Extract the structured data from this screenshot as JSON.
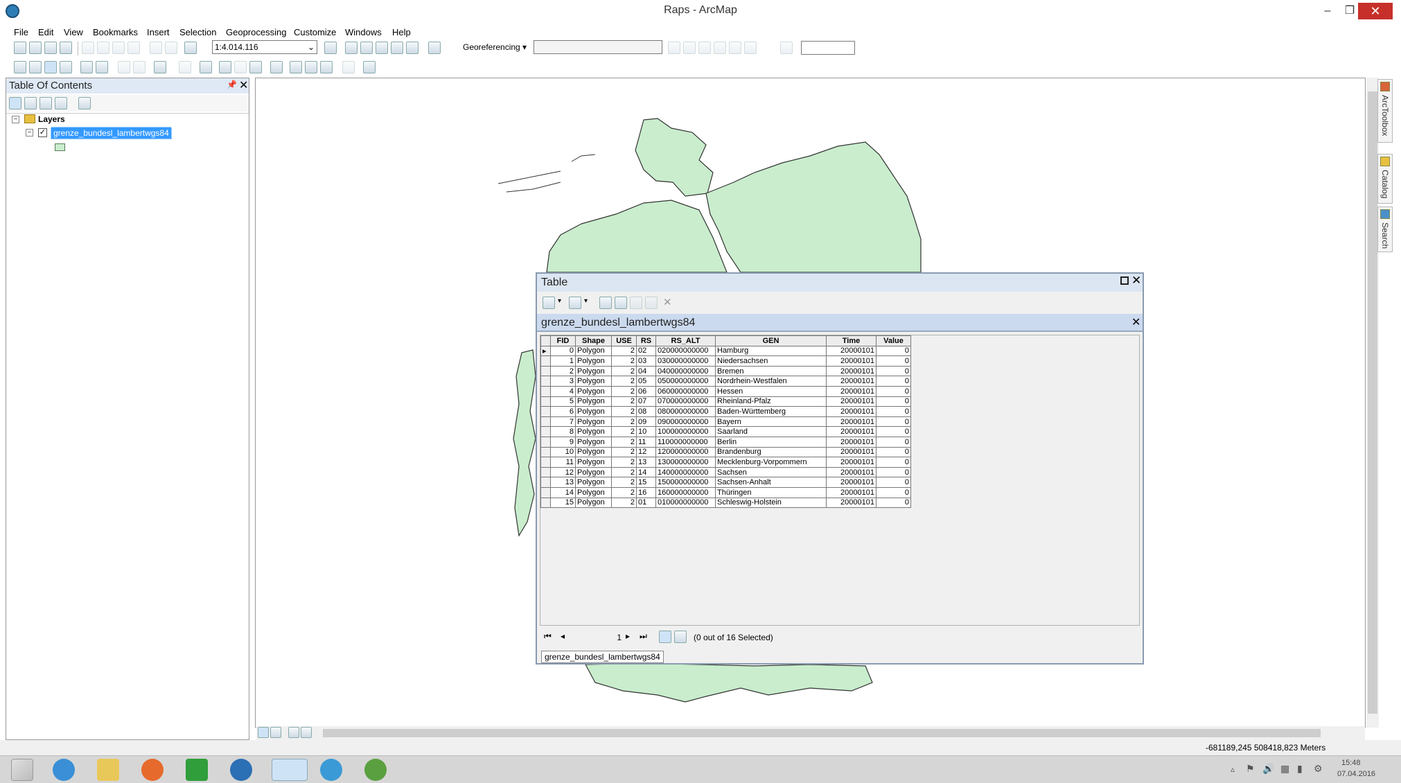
{
  "window": {
    "title": "Raps - ArcMap"
  },
  "menu": [
    "File",
    "Edit",
    "View",
    "Bookmarks",
    "Insert",
    "Selection",
    "Geoprocessing",
    "Customize",
    "Windows",
    "Help"
  ],
  "toolbar": {
    "scale": "1:4.014.116",
    "georeferencing_label": "Georeferencing ▾"
  },
  "toc": {
    "title": "Table Of Contents",
    "root_label": "Layers",
    "layer_name": "grenze_bundesl_lambertwgs84"
  },
  "dock_tabs": [
    "ArcToolbox",
    "Catalog",
    "Search"
  ],
  "table_window": {
    "title": "Table",
    "layer_title": "grenze_bundesl_lambertwgs84",
    "columns": [
      "FID",
      "Shape",
      "USE",
      "RS",
      "RS_ALT",
      "GEN",
      "Time",
      "Value"
    ],
    "rows": [
      [
        "0",
        "Polygon",
        "2",
        "02",
        "020000000000",
        "Hamburg",
        "20000101",
        "0"
      ],
      [
        "1",
        "Polygon",
        "2",
        "03",
        "030000000000",
        "Niedersachsen",
        "20000101",
        "0"
      ],
      [
        "2",
        "Polygon",
        "2",
        "04",
        "040000000000",
        "Bremen",
        "20000101",
        "0"
      ],
      [
        "3",
        "Polygon",
        "2",
        "05",
        "050000000000",
        "Nordrhein-Westfalen",
        "20000101",
        "0"
      ],
      [
        "4",
        "Polygon",
        "2",
        "06",
        "060000000000",
        "Hessen",
        "20000101",
        "0"
      ],
      [
        "5",
        "Polygon",
        "2",
        "07",
        "070000000000",
        "Rheinland-Pfalz",
        "20000101",
        "0"
      ],
      [
        "6",
        "Polygon",
        "2",
        "08",
        "080000000000",
        "Baden-Württemberg",
        "20000101",
        "0"
      ],
      [
        "7",
        "Polygon",
        "2",
        "09",
        "090000000000",
        "Bayern",
        "20000101",
        "0"
      ],
      [
        "8",
        "Polygon",
        "2",
        "10",
        "100000000000",
        "Saarland",
        "20000101",
        "0"
      ],
      [
        "9",
        "Polygon",
        "2",
        "11",
        "110000000000",
        "Berlin",
        "20000101",
        "0"
      ],
      [
        "10",
        "Polygon",
        "2",
        "12",
        "120000000000",
        "Brandenburg",
        "20000101",
        "0"
      ],
      [
        "11",
        "Polygon",
        "2",
        "13",
        "130000000000",
        "Mecklenburg-Vorpommern",
        "20000101",
        "0"
      ],
      [
        "12",
        "Polygon",
        "2",
        "14",
        "140000000000",
        "Sachsen",
        "20000101",
        "0"
      ],
      [
        "13",
        "Polygon",
        "2",
        "15",
        "150000000000",
        "Sachsen-Anhalt",
        "20000101",
        "0"
      ],
      [
        "14",
        "Polygon",
        "2",
        "16",
        "160000000000",
        "Thüringen",
        "20000101",
        "0"
      ],
      [
        "15",
        "Polygon",
        "2",
        "01",
        "010000000000",
        "Schleswig-Holstein",
        "20000101",
        "0"
      ]
    ],
    "page": "1",
    "selection_status": "(0 out of 16 Selected)",
    "layer_tab": "grenze_bundesl_lambertwgs84"
  },
  "status": {
    "coordinates": "-681189,245  508418,823 Meters"
  },
  "taskbar": {
    "time": "15:48",
    "date": "07.04.2016"
  },
  "colors": {
    "map_fill": "#c9edcd",
    "selection": "#3399ff",
    "close_red": "#c7302a"
  }
}
